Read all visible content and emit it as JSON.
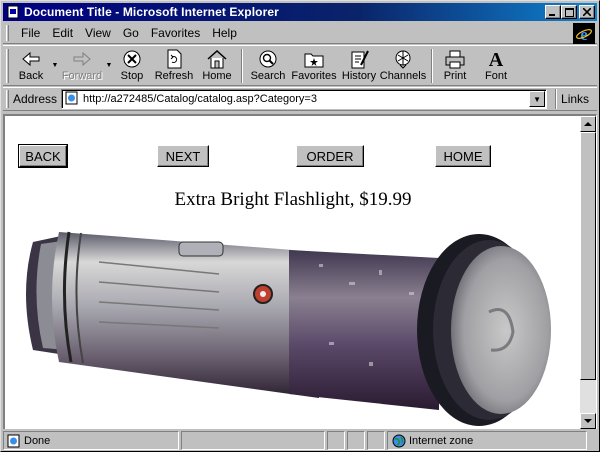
{
  "window": {
    "title": "Document Title - Microsoft Internet Explorer",
    "controls": {
      "minimize": "_",
      "maximize": "□",
      "close": "×"
    }
  },
  "menu": {
    "items": [
      {
        "label": "File",
        "key": "F"
      },
      {
        "label": "Edit",
        "key": "E"
      },
      {
        "label": "View",
        "key": "V"
      },
      {
        "label": "Go",
        "key": "G"
      },
      {
        "label": "Favorites",
        "key": "a"
      },
      {
        "label": "Help",
        "key": "H"
      }
    ]
  },
  "toolbar": {
    "back": "Back",
    "forward": "Forward",
    "stop": "Stop",
    "refresh": "Refresh",
    "home": "Home",
    "search": "Search",
    "favorites": "Favorites",
    "history": "History",
    "channels": "Channels",
    "print": "Print",
    "font": "Font"
  },
  "address": {
    "label": "Address",
    "url": "http://a272485/Catalog/catalog.asp?Category=3",
    "links_label": "Links"
  },
  "page": {
    "nav_buttons": {
      "back": "BACK",
      "next": "NEXT",
      "order": "ORDER",
      "home": "HOME"
    },
    "product_title": "Extra Bright Flashlight, $19.99"
  },
  "status": {
    "text": "Done",
    "zone": "Internet zone"
  },
  "colors": {
    "titlebar": "#000080",
    "chrome": "#c0c0c0",
    "content_bg": "#ffffff"
  }
}
